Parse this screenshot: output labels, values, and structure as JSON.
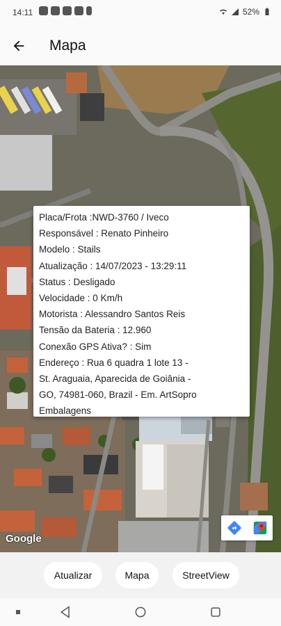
{
  "status_bar": {
    "time": "14:11",
    "battery": "52%",
    "icons": [
      "whatsapp-icon",
      "chat-icon",
      "settings-icon",
      "photo-icon",
      "lock-icon",
      "wifi-icon",
      "signal-icon",
      "battery-icon"
    ]
  },
  "app_bar": {
    "title": "Mapa",
    "back_icon": "arrow-left-icon"
  },
  "info_window": {
    "plate": "Placa/Frota :NWD-3760 / Iveco",
    "responsible": "Responsável : Renato Pinheiro",
    "model": "Modelo : Stails",
    "updated": "Atualização : 14/07/2023 - 13:29:11",
    "status": "Status : Desligado",
    "speed": "Velocidade : 0 Km/h",
    "driver": "Motorista : Alessandro Santos Reis",
    "battery_voltage": "Tensão da Bateria : 12.960",
    "gps": "Conexão GPS Ativa? : Sim",
    "address_line1": "Endereço : Rua 6 quadra 1 lote 13 -",
    "address_line2": "St. Araguaia, Aparecida de Goiânia -",
    "address_line3": "GO, 74981-060, Brazil - Em. ArtSopro",
    "address_line4": "Embalagens"
  },
  "map": {
    "attribution": "Google",
    "tools": [
      "directions-icon",
      "google-maps-icon"
    ]
  },
  "actions": {
    "update_label": "Atualizar",
    "map_label": "Mapa",
    "streetview_label": "StreetView"
  },
  "nav_bar": {
    "icons": [
      "recents-icon",
      "back-icon",
      "home-icon",
      "overview-icon"
    ]
  },
  "colors": {
    "directions_blue": "#4285F4",
    "maps_green": "#0F9D58",
    "maps_red": "#DB4437"
  }
}
